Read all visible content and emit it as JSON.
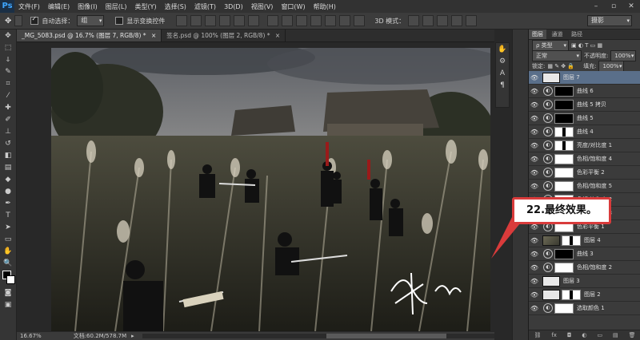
{
  "menubar": {
    "logo": "Ps",
    "items": [
      "文件(F)",
      "编辑(E)",
      "图像(I)",
      "图层(L)",
      "类型(Y)",
      "选择(S)",
      "滤镜(T)",
      "3D(D)",
      "视图(V)",
      "窗口(W)",
      "帮助(H)"
    ],
    "window_controls": [
      "–",
      "▫",
      "✕"
    ]
  },
  "options": {
    "auto_select_label": "自动选择：",
    "auto_select_value": "组",
    "show_transform_label": "显示变换控件",
    "mode_3d_label": "3D 模式：",
    "workspace_value": "摄影"
  },
  "tabs": [
    {
      "label": "_MG_5083.psd @ 16.7% (图层 7, RGB/8) *",
      "close": "×"
    },
    {
      "label": "签名.psd @ 100% (图层 2, RGB/8) *",
      "close": "×"
    }
  ],
  "status": {
    "zoom": "16.67%",
    "doc": "文档:60.2M/578.7M"
  },
  "callout": {
    "text": "22.最终效果。"
  },
  "panel": {
    "tabs": [
      "图层",
      "通道",
      "路径"
    ],
    "filter_kind": "ρ 类型",
    "blend_mode": "正常",
    "opacity_label": "不透明度:",
    "opacity_value": "100%",
    "lock_label": "锁定:",
    "fill_label": "填充:",
    "fill_value": "100%",
    "layers": [
      {
        "name": "图层 7",
        "type": "pixel",
        "thumb": "plain",
        "selected": true
      },
      {
        "name": "曲线 6",
        "type": "adj",
        "mask": "black"
      },
      {
        "name": "曲线 5 拷贝",
        "type": "adj",
        "mask": "black"
      },
      {
        "name": "曲线 5",
        "type": "adj",
        "mask": "black"
      },
      {
        "name": "曲线 4",
        "type": "adj",
        "mask": "mixed"
      },
      {
        "name": "亮度/对比度 1",
        "type": "adj",
        "mask": "mixed"
      },
      {
        "name": "色相/饱和度 4",
        "type": "adj",
        "mask": "white"
      },
      {
        "name": "色彩平衡 2",
        "type": "adj",
        "mask": "white"
      },
      {
        "name": "色相/饱和度 5",
        "type": "adj",
        "mask": "white"
      },
      {
        "name": "色相/饱和度 2",
        "type": "adj",
        "mask": "white"
      },
      {
        "name": "色相/饱和度 3",
        "type": "adj",
        "mask": "white"
      },
      {
        "name": "色彩平衡 1",
        "type": "adj",
        "mask": "white"
      },
      {
        "name": "图层 4",
        "type": "pixel",
        "thumb": "pic",
        "mask": "mixed"
      },
      {
        "name": "曲线 3",
        "type": "adj",
        "mask": "black"
      },
      {
        "name": "色相/饱和度 2",
        "type": "adj",
        "mask": "white"
      },
      {
        "name": "图层 3",
        "type": "pixel",
        "thumb": "plain"
      },
      {
        "name": "图层 2",
        "type": "pixel",
        "thumb": "plain",
        "mask": "mixed"
      },
      {
        "name": "选取颜色 1",
        "type": "adj",
        "mask": "white"
      }
    ],
    "footer_icons": [
      "⛓",
      "fx",
      "◘",
      "◐",
      "▭",
      "▤",
      "🗑"
    ]
  },
  "photo": {
    "signature": "揚 亦帆"
  },
  "colors": {
    "accent": "#d93b3b",
    "selected_layer": "#5a6f8a"
  }
}
